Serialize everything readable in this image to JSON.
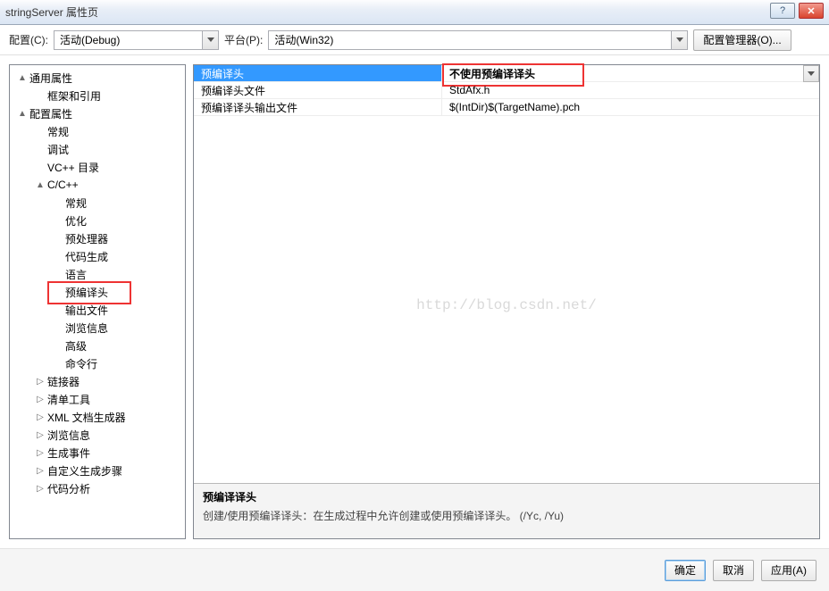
{
  "window_title": "stringServer 属性页",
  "toolbar": {
    "config_label": "配置(C):",
    "config_value": "活动(Debug)",
    "platform_label": "平台(P):",
    "platform_value": "活动(Win32)",
    "config_manager": "配置管理器(O)..."
  },
  "tree": [
    {
      "level": 0,
      "glyph": "▲",
      "label": "通用属性"
    },
    {
      "level": 1,
      "glyph": "",
      "label": "框架和引用"
    },
    {
      "level": 0,
      "glyph": "▲",
      "label": "配置属性"
    },
    {
      "level": 1,
      "glyph": "",
      "label": "常规"
    },
    {
      "level": 1,
      "glyph": "",
      "label": "调试"
    },
    {
      "level": 1,
      "glyph": "",
      "label": "VC++ 目录"
    },
    {
      "level": 1,
      "glyph": "▲",
      "label": "C/C++"
    },
    {
      "level": 2,
      "glyph": "",
      "label": "常规"
    },
    {
      "level": 2,
      "glyph": "",
      "label": "优化"
    },
    {
      "level": 2,
      "glyph": "",
      "label": "预处理器"
    },
    {
      "level": 2,
      "glyph": "",
      "label": "代码生成"
    },
    {
      "level": 2,
      "glyph": "",
      "label": "语言"
    },
    {
      "level": 2,
      "glyph": "",
      "label": "预编译头",
      "highlight": true
    },
    {
      "level": 2,
      "glyph": "",
      "label": "输出文件"
    },
    {
      "level": 2,
      "glyph": "",
      "label": "浏览信息"
    },
    {
      "level": 2,
      "glyph": "",
      "label": "高级"
    },
    {
      "level": 2,
      "glyph": "",
      "label": "命令行"
    },
    {
      "level": 1,
      "glyph": "▷",
      "label": "链接器"
    },
    {
      "level": 1,
      "glyph": "▷",
      "label": "清单工具"
    },
    {
      "level": 1,
      "glyph": "▷",
      "label": "XML 文档生成器"
    },
    {
      "level": 1,
      "glyph": "▷",
      "label": "浏览信息"
    },
    {
      "level": 1,
      "glyph": "▷",
      "label": "生成事件"
    },
    {
      "level": 1,
      "glyph": "▷",
      "label": "自定义生成步骤"
    },
    {
      "level": 1,
      "glyph": "▷",
      "label": "代码分析"
    }
  ],
  "grid": {
    "rows": [
      {
        "name": "预编译头",
        "value": "不使用预编译译头",
        "selected": true
      },
      {
        "name": "预编译头文件",
        "value": "StdAfx.h"
      },
      {
        "name": "预编译译头输出文件",
        "value": "$(IntDir)$(TargetName).pch"
      }
    ]
  },
  "watermark": "http://blog.csdn.net/",
  "description": {
    "title": "预编译译头",
    "body": "创建/使用预编译译头：在生成过程中允许创建或使用预编译译头。     (/Yc, /Yu)"
  },
  "buttons": {
    "ok": "确定",
    "cancel": "取消",
    "apply": "应用(A)"
  },
  "winbtn_help": "?",
  "winbtn_close": "✕"
}
